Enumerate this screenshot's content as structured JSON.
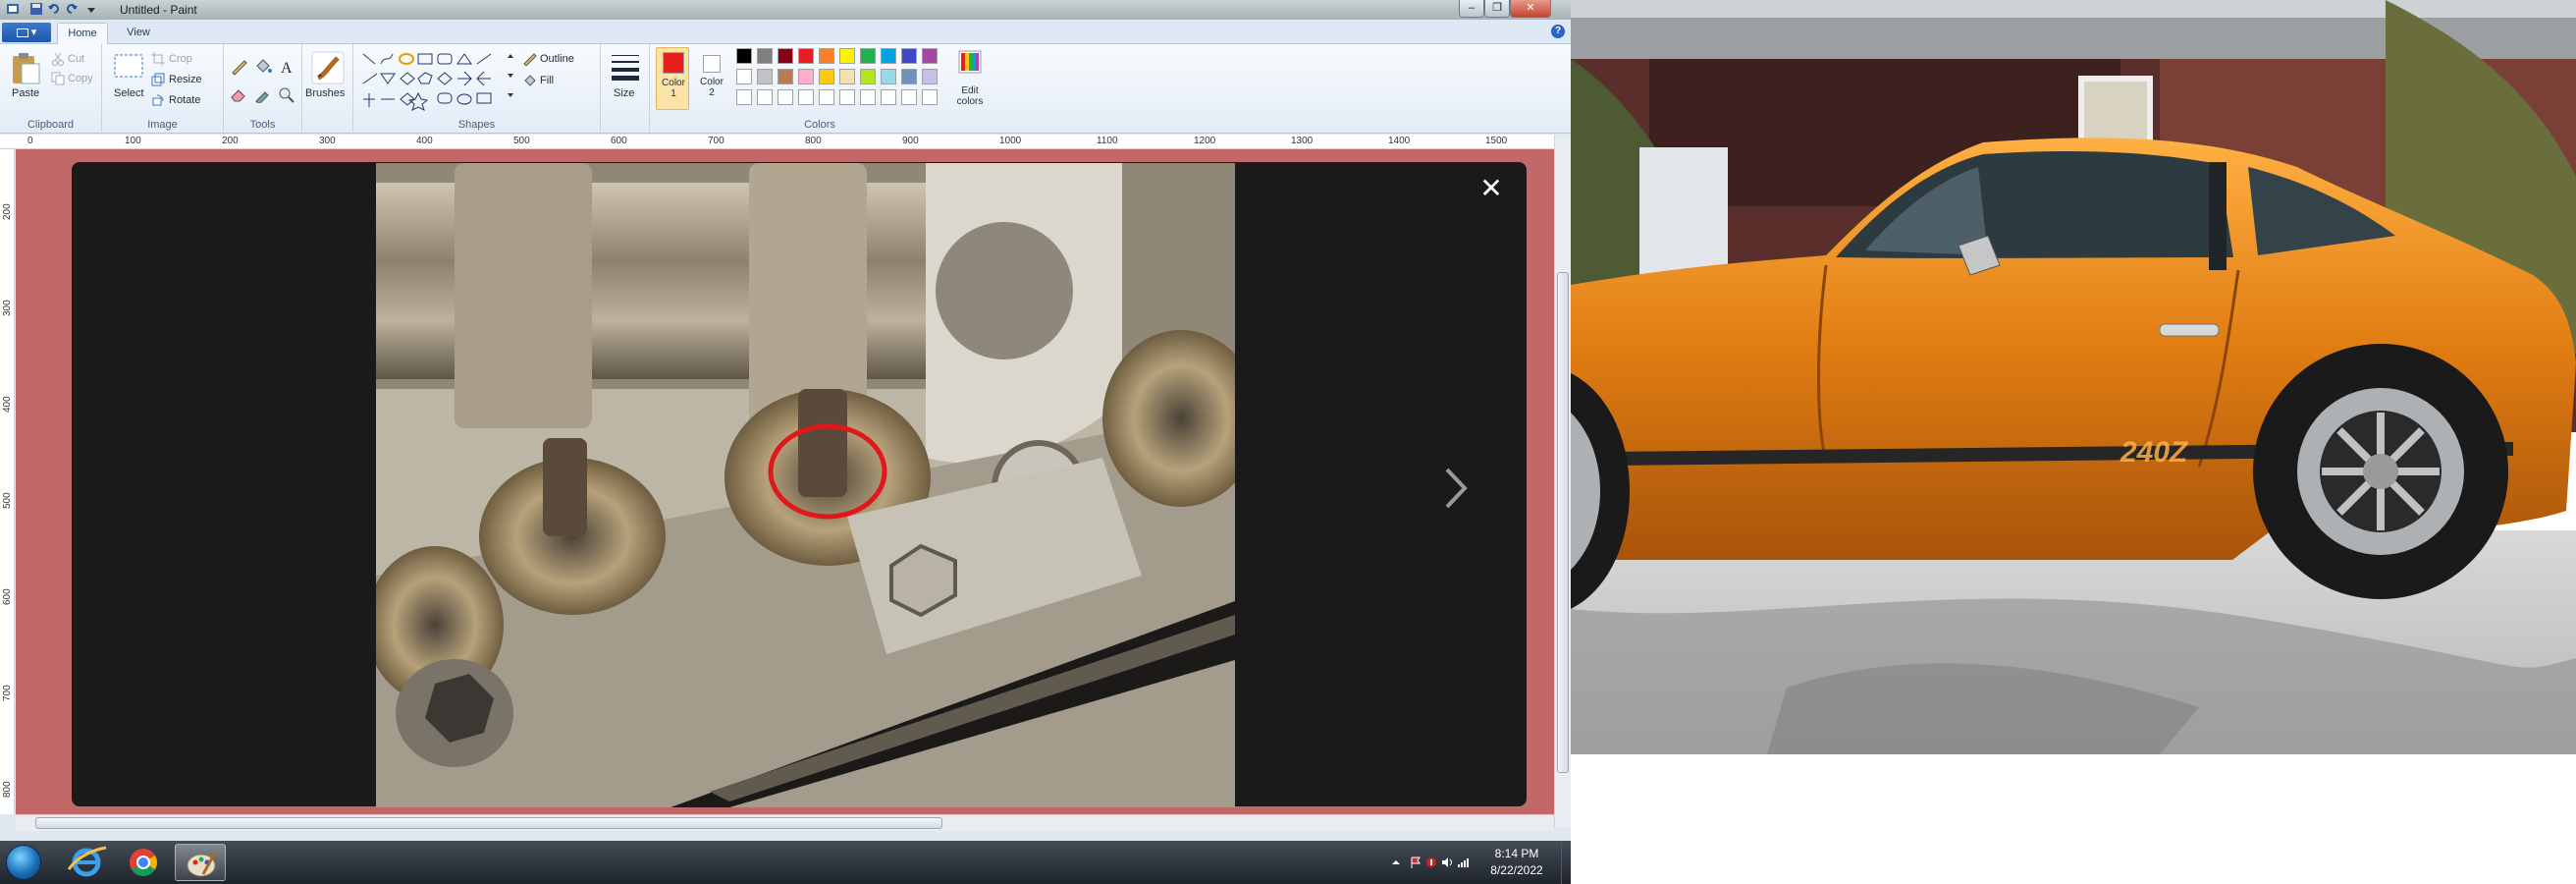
{
  "window": {
    "title": "Untitled - Paint",
    "controls": {
      "minimize": "–",
      "maximize": "❐",
      "close": "✕"
    }
  },
  "menu": {
    "file_glyph": "▾",
    "tabs": [
      "Home",
      "View"
    ],
    "help": "?"
  },
  "ribbon": {
    "clipboard": {
      "paste": "Paste",
      "cut": "Cut",
      "copy": "Copy",
      "group": "Clipboard"
    },
    "image": {
      "select": "Select",
      "crop": "Crop",
      "resize": "Resize",
      "rotate": "Rotate",
      "group": "Image"
    },
    "tools": {
      "group": "Tools"
    },
    "brushes": {
      "label": "Brushes"
    },
    "shapes": {
      "outline": "Outline",
      "fill": "Fill",
      "group": "Shapes"
    },
    "size": {
      "label": "Size"
    },
    "colors": {
      "color1": "Color 1",
      "color2": "Color 2",
      "edit": "Edit colors",
      "group": "Colors",
      "color1_value": "#e8201c",
      "color2_value": "#ffffff",
      "palette_row1": [
        "#000000",
        "#7f7f7f",
        "#880015",
        "#ed1c24",
        "#ff7f27",
        "#fff200",
        "#22b14c",
        "#00a2e8",
        "#3f48cc",
        "#a349a4"
      ],
      "palette_row2": [
        "#ffffff",
        "#c3c3c3",
        "#b97a57",
        "#ffaec9",
        "#ffc90e",
        "#efe4b0",
        "#b5e61d",
        "#99d9ea",
        "#7092be",
        "#c8bfe7"
      ],
      "palette_row3": [
        "#ffffff",
        "#ffffff",
        "#ffffff",
        "#ffffff",
        "#ffffff",
        "#ffffff",
        "#ffffff",
        "#ffffff",
        "#ffffff",
        "#ffffff"
      ]
    }
  },
  "ruler": {
    "h_ticks": [
      "0",
      "100",
      "200",
      "300",
      "400",
      "500",
      "600",
      "700",
      "800",
      "900",
      "1000",
      "1100",
      "1200",
      "1300",
      "1400",
      "1500"
    ],
    "v_ticks": [
      "200",
      "300",
      "400",
      "500",
      "600",
      "700",
      "800"
    ]
  },
  "canvas": {
    "overlay_close": "✕",
    "next": "›"
  },
  "taskbar": {
    "apps": [
      "internet-explorer",
      "chrome",
      "paint"
    ],
    "time": "8:14 PM",
    "date": "8/22/2022"
  },
  "car_photo": {
    "badge_text": "240Z"
  }
}
